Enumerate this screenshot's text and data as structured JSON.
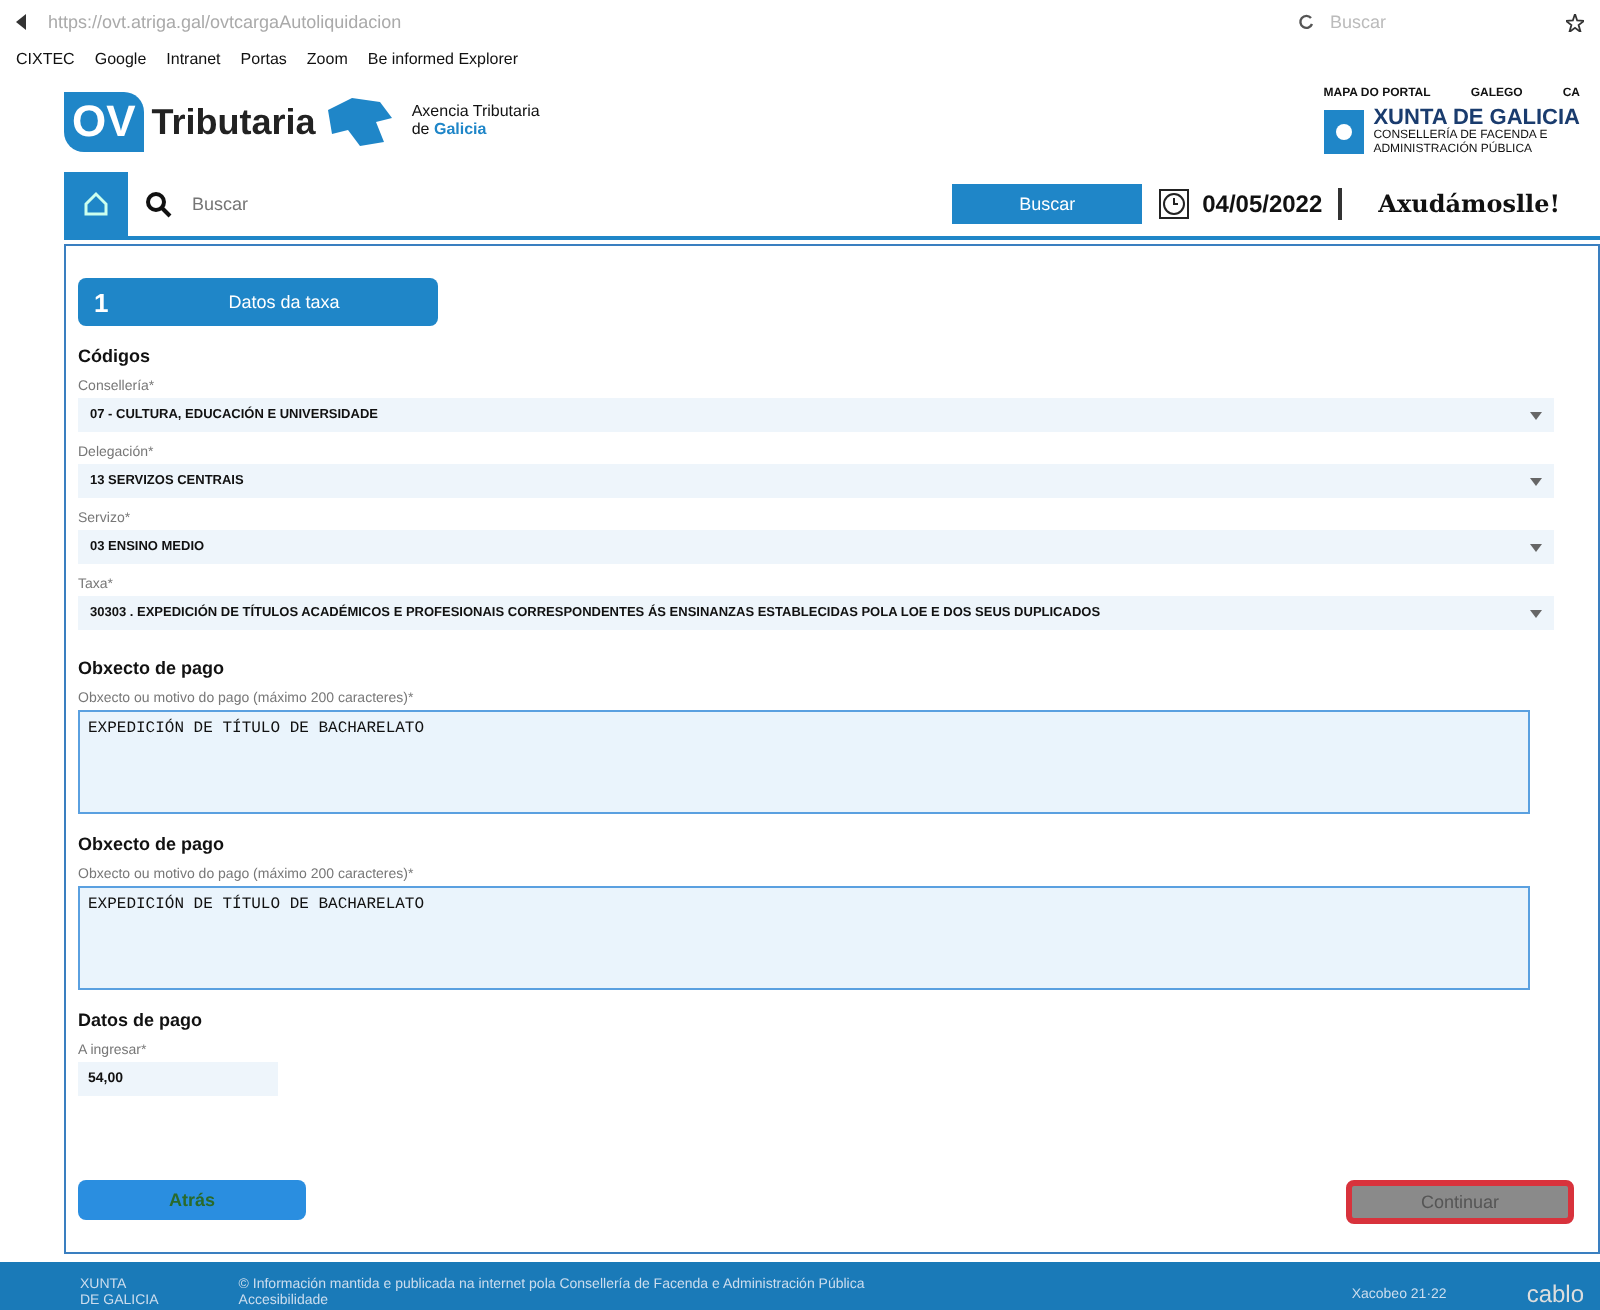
{
  "browser": {
    "url": "https://ovt.atriga.gal/ovtcargaAutoliquidacion",
    "search_placeholder": "Buscar",
    "bookmarks": [
      "CIXTEC",
      "Google",
      "Intranet",
      "Portas",
      "Zoom",
      "Be informed Explorer"
    ]
  },
  "header": {
    "logo_short": "OV",
    "logo_name": "Tributaria",
    "agency_line1": "Axencia Tributaria",
    "agency_line2_prefix": "de",
    "agency_line2_bold": "Galicia",
    "top_links": [
      "MAPA DO PORTAL",
      "GALEGO",
      "CA"
    ],
    "xunta_title": "XUNTA DE GALICIA",
    "xunta_line1": "CONSELLERÍA DE FACENDA E",
    "xunta_line2": "ADMINISTRACIÓN PÚBLICA"
  },
  "navbar": {
    "search_placeholder": "Buscar",
    "search_button": "Buscar",
    "date": "04/05/2022",
    "help": "Axudámoslle!"
  },
  "step": {
    "number": "1",
    "label": "Datos da taxa"
  },
  "codes": {
    "heading": "Códigos",
    "fields": [
      {
        "label": "Consellería*",
        "value": "07 - CULTURA, EDUCACIÓN E UNIVERSIDADE"
      },
      {
        "label": "Delegación*",
        "value": "13   SERVIZOS CENTRAIS"
      },
      {
        "label": "Servizo*",
        "value": "03   ENSINO MEDIO"
      },
      {
        "label": "Taxa*",
        "value": "30303 . EXPEDICIÓN DE TÍTULOS ACADÉMICOS E PROFESIONAIS CORRESPONDENTES ÁS ENSINANZAS ESTABLECIDAS POLA LOE E DOS SEUS DUPLICADOS"
      }
    ]
  },
  "objects": [
    {
      "heading": "Obxecto de pago",
      "label": "Obxecto ou motivo do pago (máximo 200 caracteres)*",
      "value": "EXPEDICIÓN DE TÍTULO DE BACHARELATO"
    },
    {
      "heading": "Obxecto de pago",
      "label": "Obxecto ou motivo do pago (máximo 200 caracteres)*",
      "value": "EXPEDICIÓN DE TÍTULO DE BACHARELATO"
    }
  ],
  "payment": {
    "heading": "Datos de pago",
    "label": "A ingresar*",
    "value": "54,00"
  },
  "buttons": {
    "back": "Atrás",
    "continue": "Continuar"
  },
  "footer": {
    "logo_line1": "XUNTA",
    "logo_line2": "DE GALICIA",
    "text": "© Información mantida e publicada na internet pola Consellería de Facenda e Administración Pública",
    "text2": "Accesibilidade",
    "xacobeo": "Xacobeo 21·22",
    "right": "cablo"
  }
}
